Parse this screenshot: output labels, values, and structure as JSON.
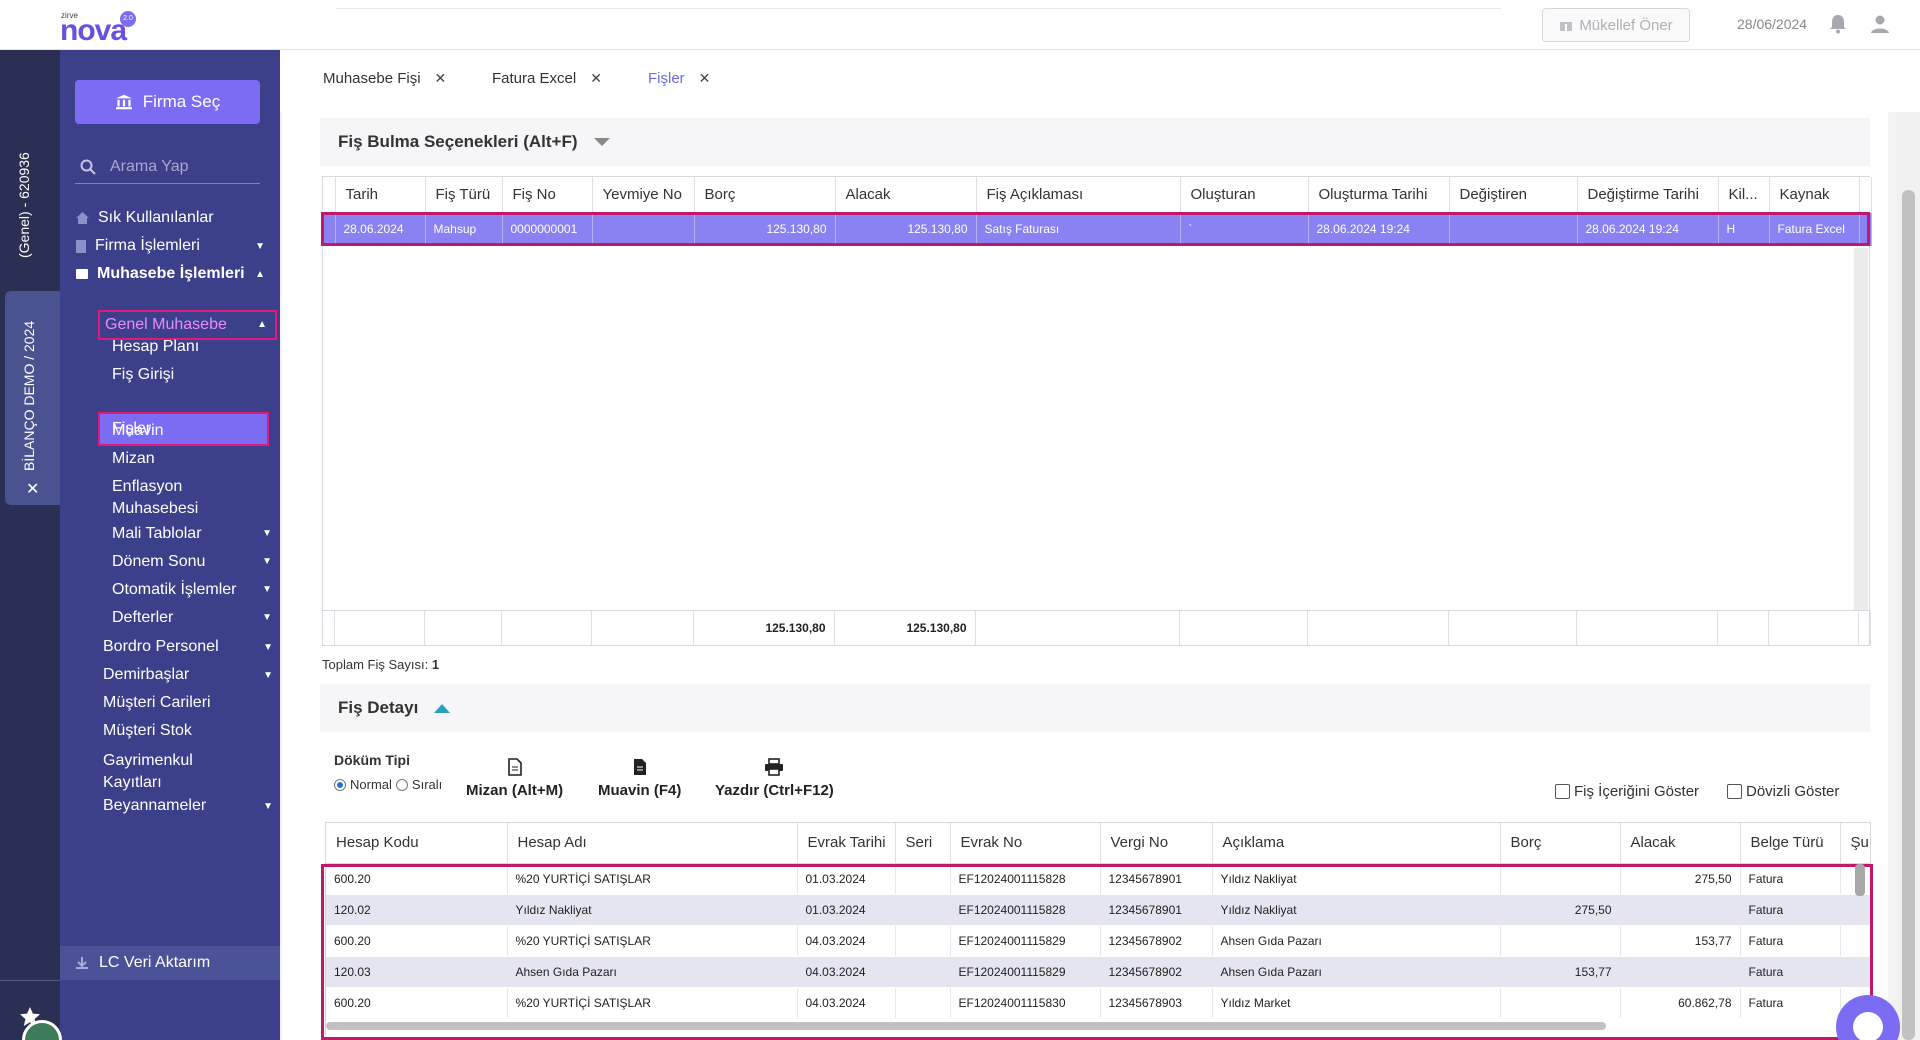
{
  "header": {
    "logo_small": "zirve",
    "logo_big": "nova",
    "logo_version": "2.0",
    "mukellef_label": "Mükellef Öner",
    "date": "28/06/2024"
  },
  "rail": {
    "code": "(Genel) - 620936",
    "firm": "BİLANÇO DEMO / 2024"
  },
  "sidebar": {
    "firma_sec": "Firma Seç",
    "search_placeholder": "Arama Yap",
    "items": [
      {
        "label": "Sık Kullanılanlar"
      },
      {
        "label": "Firma İşlemleri"
      },
      {
        "label": "Muhasebe İşlemleri"
      },
      {
        "label": "Genel Muhasebe"
      },
      {
        "label": "Hesap Planı"
      },
      {
        "label": "Fiş Girişi"
      },
      {
        "label": "Fişler"
      },
      {
        "label": "Muavin"
      },
      {
        "label": "Mizan"
      },
      {
        "label": "Enflasyon Muhasebesi"
      },
      {
        "label": "Mali Tablolar"
      },
      {
        "label": "Dönem Sonu"
      },
      {
        "label": "Otomatik İşlemler"
      },
      {
        "label": "Defterler"
      },
      {
        "label": "Bordro Personel"
      },
      {
        "label": "Demirbaşlar"
      },
      {
        "label": "Müşteri Carileri"
      },
      {
        "label": "Müşteri Stok"
      },
      {
        "label": "Gayrimenkul Kayıtları"
      },
      {
        "label": "Beyannameler"
      },
      {
        "label": "LC Veri Aktarım"
      }
    ]
  },
  "tabs": [
    {
      "label": "Muhasebe Fişi"
    },
    {
      "label": "Fatura Excel"
    },
    {
      "label": "Fişler"
    }
  ],
  "search_section": {
    "title": "Fiş Bulma Seçenekleri (Alt+F)"
  },
  "fis_table": {
    "columns": [
      "Tarih",
      "Fiş Türü",
      "Fiş No",
      "Yevmiye No",
      "Borç",
      "Alacak",
      "Fiş Açıklaması",
      "Oluşturan",
      "Oluşturma Tarihi",
      "Değiştiren",
      "Değiştirme Tarihi",
      "Kil...",
      "Kaynak"
    ],
    "row": [
      "28.06.2024",
      "Mahsup",
      "0000000001",
      "",
      "125.130,80",
      "125.130,80",
      "Satış Faturası",
      "`",
      "28.06.2024 19:24",
      "",
      "28.06.2024 19:24",
      "H",
      "Fatura Excel"
    ],
    "footer_borc": "125.130,80",
    "footer_alacak": "125.130,80",
    "total_label": "Toplam Fiş Sayısı:",
    "total_value": "1"
  },
  "detail_section": {
    "title": "Fiş Detayı",
    "dokum_label": "Döküm Tipi",
    "radio_normal": "Normal",
    "radio_sirali": "Sıralı",
    "mizan": "Mizan (Alt+M)",
    "muavin": "Muavin (F4)",
    "yazdir": "Yazdır (Ctrl+F12)",
    "fis_icerigi": "Fiş İçeriğini Göster",
    "dovizli": "Dövizli Göster"
  },
  "detail_table": {
    "columns": [
      "Hesap Kodu",
      "Hesap Adı",
      "Evrak Tarihi",
      "Seri",
      "Evrak No",
      "Vergi No",
      "Açıklama",
      "Borç",
      "Alacak",
      "Belge Türü",
      "Şu"
    ],
    "rows": [
      [
        "600.20",
        "%20 YURTİÇİ SATIŞLAR",
        "01.03.2024",
        "",
        "EF12024001115828",
        "12345678901",
        "Yıldız Nakliyat",
        "",
        "275,50",
        "Fatura"
      ],
      [
        "120.02",
        "Yıldız Nakliyat",
        "01.03.2024",
        "",
        "EF12024001115828",
        "12345678901",
        "Yıldız Nakliyat",
        "275,50",
        "",
        "Fatura"
      ],
      [
        "600.20",
        "%20 YURTİÇİ SATIŞLAR",
        "04.03.2024",
        "",
        "EF12024001115829",
        "12345678902",
        "Ahsen Gıda Pazarı",
        "",
        "153,77",
        "Fatura"
      ],
      [
        "120.03",
        "Ahsen Gıda Pazarı",
        "04.03.2024",
        "",
        "EF12024001115829",
        "12345678902",
        "Ahsen Gıda Pazarı",
        "153,77",
        "",
        "Fatura"
      ],
      [
        "600.20",
        "%20 YURTİÇİ SATIŞLAR",
        "04.03.2024",
        "",
        "EF12024001115830",
        "12345678903",
        "Yıldız Market",
        "",
        "60.862,78",
        "Fatura"
      ]
    ]
  }
}
